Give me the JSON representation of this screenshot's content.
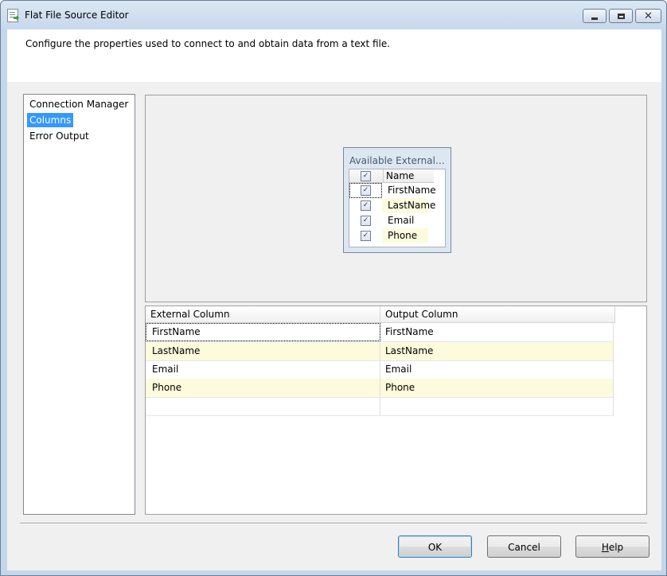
{
  "window": {
    "title": "Flat File Source Editor",
    "icon": "flat-file-source-icon"
  },
  "header": {
    "description": "Configure the properties used to connect to and obtain data from a text file."
  },
  "nav": {
    "items": [
      {
        "label": "Connection Manager",
        "selected": false
      },
      {
        "label": "Columns",
        "selected": true
      },
      {
        "label": "Error Output",
        "selected": false
      }
    ]
  },
  "available_columns": {
    "title": "Available External Co...",
    "header_name": "Name",
    "header_checked": true,
    "rows": [
      {
        "name": "FirstName",
        "checked": true
      },
      {
        "name": "LastName",
        "checked": true
      },
      {
        "name": "Email",
        "checked": true
      },
      {
        "name": "Phone",
        "checked": true
      }
    ]
  },
  "mapping_grid": {
    "columns": [
      "External Column",
      "Output Column"
    ],
    "rows": [
      [
        "FirstName",
        "FirstName"
      ],
      [
        "LastName",
        "LastName"
      ],
      [
        "Email",
        "Email"
      ],
      [
        "Phone",
        "Phone"
      ]
    ]
  },
  "buttons": {
    "ok": "OK",
    "cancel": "Cancel",
    "help_mnemonic": "H",
    "help_rest": "elp"
  },
  "colors": {
    "selection": "#3399ff",
    "alt_row": "#fcfbdc",
    "dialog_background": "#f0f0f0"
  }
}
